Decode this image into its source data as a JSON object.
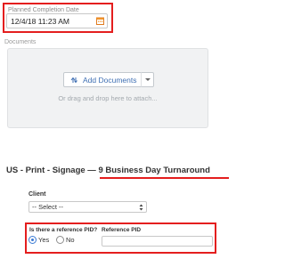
{
  "planned_completion": {
    "label": "Planned Completion Date",
    "value": "12/4/18 11:23 AM",
    "icon": "calendar-icon"
  },
  "documents": {
    "label": "Documents",
    "add_button_label": "Add Documents",
    "drop_hint": "Or drag and drop here to attach..."
  },
  "form": {
    "title": "US - Print - Signage — 9 Business Day Turnaround"
  },
  "client": {
    "label": "Client",
    "selected": "-- Select --"
  },
  "reference": {
    "question": "Is there a reference PID?",
    "options": [
      "Yes",
      "No"
    ],
    "selected": "Yes",
    "pid_label": "Reference PID",
    "pid_value": ""
  },
  "colors": {
    "highlight": "#e41e1e",
    "link_blue": "#3f6fb3",
    "calendar_accent": "#f0942b"
  }
}
